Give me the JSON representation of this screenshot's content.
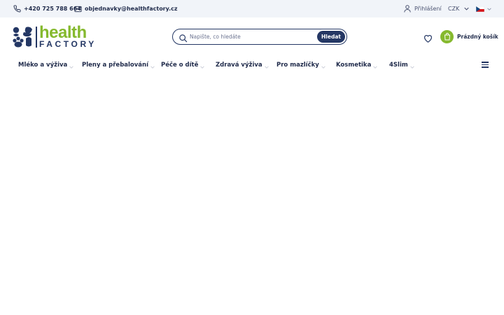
{
  "topbar": {
    "phone": "+420 725 788 664",
    "email": "objednavky@healthfactory.cz",
    "login": "Přihlášení",
    "currency": "CZK",
    "language_flag": "flag-cz-icon"
  },
  "header": {
    "logo": {
      "line1": "health",
      "line2": "FACTORY"
    },
    "search": {
      "placeholder": "Napište, co hledáte",
      "value": "",
      "button": "Hledat"
    },
    "cart_label": "Prázdný košík"
  },
  "nav": {
    "items": [
      {
        "label": "Mléko a výživa",
        "has_dropdown": true
      },
      {
        "label": "Pleny a přebalování",
        "has_dropdown": true
      },
      {
        "label": "Péče o dítě",
        "has_dropdown": true
      },
      {
        "label": "Zdravá výživa",
        "has_dropdown": true
      },
      {
        "label": "Pro mazlíčky",
        "has_dropdown": true
      },
      {
        "label": "Kosmetika",
        "has_dropdown": true
      },
      {
        "label": "4Slim",
        "has_dropdown": true
      }
    ]
  },
  "colors": {
    "brand_navy": "#243764",
    "brand_green": "#85b92e",
    "topbar_bg": "#f1f4f9"
  }
}
